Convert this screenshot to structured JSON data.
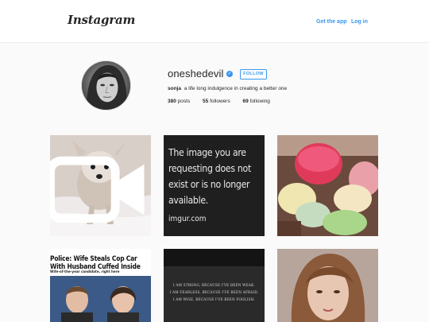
{
  "header": {
    "logo": "Instagram",
    "get_app_label": "Get the app",
    "login_label": "Log in"
  },
  "profile": {
    "username": "oneshedevil",
    "follow_label": "FOLLOW",
    "bio_name": "sonja",
    "bio_text": "a life long indulgence in creating a better one",
    "stats": [
      {
        "count": "380",
        "label": "posts"
      },
      {
        "count": "55",
        "label": "followers"
      },
      {
        "count": "69",
        "label": "following"
      }
    ]
  },
  "posts": [
    {
      "kind": "video"
    },
    {
      "kind": "image",
      "headline": "The image you are requesting does not exist or is no longer available.",
      "footer": "imgur.com"
    },
    {
      "kind": "image"
    },
    {
      "kind": "image",
      "headline": "Police: Wife Steals Cop Car With Husband Cuffed Inside",
      "sub": "Wife-of-the-year candidate, right here"
    },
    {
      "kind": "image",
      "quote_lines": [
        "I AM STRONG, BECAUSE I'VE BEEN WEAK.",
        "I AM FEARLESS, BECAUSE I'VE BEEN AFRAID.",
        "I AM WISE, BECAUSE I'VE BEEN FOOLISH."
      ]
    },
    {
      "kind": "image"
    }
  ],
  "colors": {
    "accent": "#3897f0",
    "text": "#262626",
    "background": "#fafafa"
  },
  "icons": {
    "verified": "verified-badge-icon",
    "video": "video-camera-icon"
  }
}
